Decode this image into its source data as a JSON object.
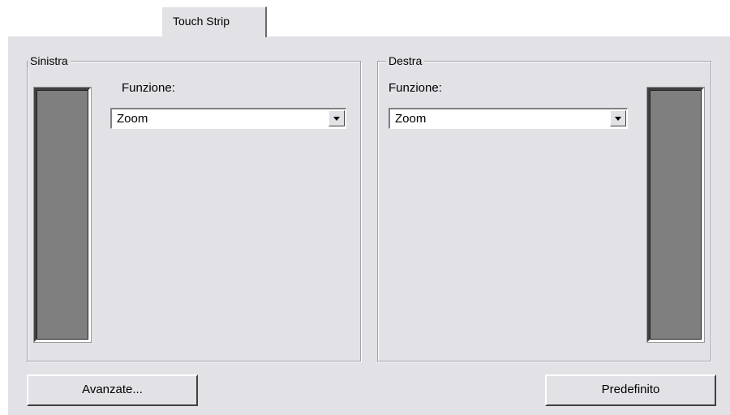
{
  "tabs": [
    {
      "label": "Touch Strip"
    }
  ],
  "left_group": {
    "title": "Sinistra",
    "function_label": "Funzione:",
    "function_value": "Zoom"
  },
  "right_group": {
    "title": "Destra",
    "function_label": "Funzione:",
    "function_value": "Zoom"
  },
  "buttons": {
    "advanced": "Avanzate...",
    "default": "Predefinito"
  },
  "icons": {
    "dropdown": "chevron-down-icon"
  },
  "colors": {
    "panel_bg": "#e2e1e6",
    "strip": "#7f7f7f"
  }
}
